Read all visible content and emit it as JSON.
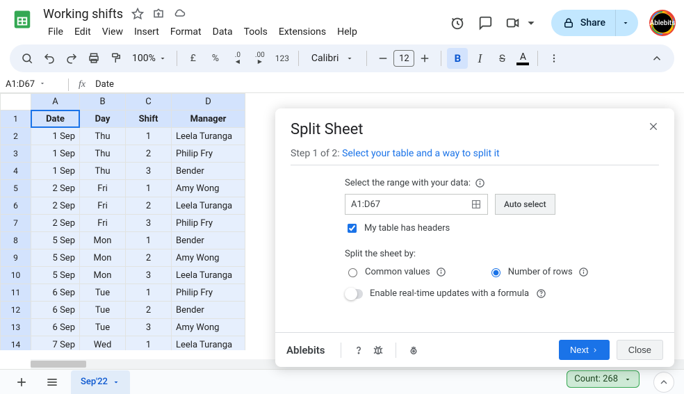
{
  "doc": {
    "title": "Working shifts",
    "avatar_label": "Ablebits"
  },
  "menu": [
    "File",
    "Edit",
    "View",
    "Insert",
    "Format",
    "Data",
    "Tools",
    "Extensions",
    "Help"
  ],
  "share": {
    "label": "Share"
  },
  "toolbar": {
    "zoom": "100%",
    "currency": "£",
    "percent": "%",
    "dec_dec": ".0",
    "dec_inc": ".00",
    "num_fmt": "123",
    "font": "Calibri",
    "font_size": "12",
    "bold": "B",
    "italic": "I",
    "strike": "S",
    "text_color": "A"
  },
  "namebox": {
    "ref": "A1:D67",
    "fx": "fx",
    "formula": "Date"
  },
  "columns": [
    "A",
    "B",
    "C",
    "D"
  ],
  "headers": [
    "Date",
    "Day",
    "Shift",
    "Manager"
  ],
  "rows": [
    [
      "1 Sep",
      "Thu",
      "1",
      "Leela Turanga"
    ],
    [
      "1 Sep",
      "Thu",
      "2",
      "Philip Fry"
    ],
    [
      "1 Sep",
      "Thu",
      "3",
      "Bender"
    ],
    [
      "2 Sep",
      "Fri",
      "1",
      "Amy Wong"
    ],
    [
      "2 Sep",
      "Fri",
      "2",
      "Leela Turanga"
    ],
    [
      "2 Sep",
      "Fri",
      "3",
      "Philip Fry"
    ],
    [
      "5 Sep",
      "Mon",
      "1",
      "Bender"
    ],
    [
      "5 Sep",
      "Mon",
      "2",
      "Amy Wong"
    ],
    [
      "5 Sep",
      "Mon",
      "3",
      "Leela Turanga"
    ],
    [
      "6 Sep",
      "Tue",
      "1",
      "Philip Fry"
    ],
    [
      "6 Sep",
      "Tue",
      "2",
      "Bender"
    ],
    [
      "6 Sep",
      "Tue",
      "3",
      "Amy Wong"
    ],
    [
      "7 Sep",
      "Wed",
      "1",
      "Leela Turanga"
    ]
  ],
  "sheet_tabs": {
    "active": "Sep'22"
  },
  "status": {
    "count_label": "Count: 268"
  },
  "panel": {
    "title": "Split Sheet",
    "step_prefix": "Step 1 of 2",
    "step_link": "Select your table and a way to split it",
    "range_label": "Select the range with your data:",
    "range_value": "A1:D67",
    "auto_select": "Auto select",
    "headers_check": "My table has headers",
    "split_by_label": "Split the sheet by:",
    "opt_common": "Common values",
    "opt_rows": "Number of rows",
    "realtime": "Enable real-time updates with a formula",
    "brand": "Ablebits",
    "next": "Next",
    "close": "Close"
  }
}
